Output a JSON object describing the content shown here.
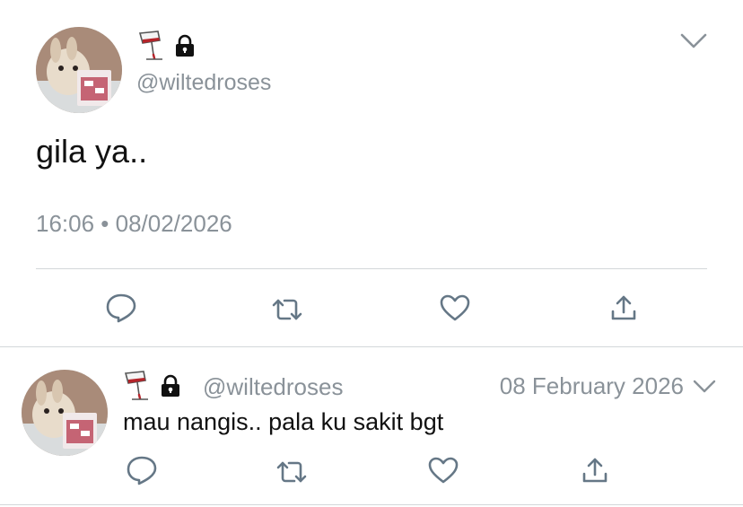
{
  "main_tweet": {
    "handle": "@wiltedroses",
    "text": "gila ya..",
    "timestamp": "16:06 • 08/02/2026",
    "name_icons": [
      "wine-glass-icon",
      "lock-icon"
    ],
    "actions": [
      "reply-icon",
      "retweet-icon",
      "like-icon",
      "share-icon"
    ]
  },
  "reply_tweet": {
    "handle": "@wiltedroses",
    "date": "08 February 2026",
    "text": "mau nangis.. pala ku sakit bgt",
    "name_icons": [
      "wine-glass-icon",
      "lock-icon"
    ],
    "actions": [
      "reply-icon",
      "retweet-icon",
      "like-icon",
      "share-icon"
    ]
  },
  "colors": {
    "text": "#14171a",
    "secondary": "#8a9299",
    "icon": "#657786",
    "divider": "#d3d7da",
    "wine": "#b5242a"
  }
}
